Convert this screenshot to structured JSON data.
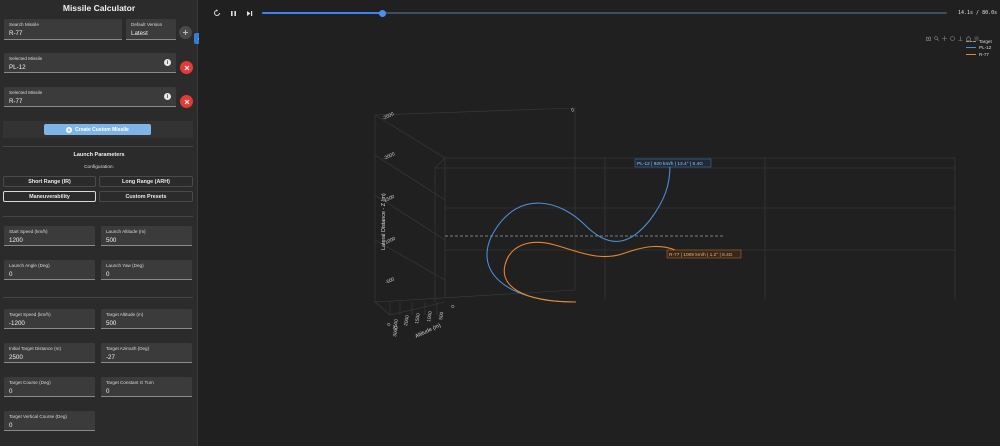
{
  "sidebar": {
    "title": "Missile Calculator",
    "search": {
      "label": "Search Missile",
      "value": "R-77"
    },
    "version": {
      "label": "Default Version",
      "value": "Latest"
    },
    "selected": [
      {
        "label": "Selected Missile",
        "value": "PL-12"
      },
      {
        "label": "Selected Missile",
        "value": "R-77"
      }
    ],
    "info_glyph": "i",
    "create_label": "Create Custom Missile",
    "launch_title": "Launch Parameters",
    "config_label": "Configuration:",
    "presets": [
      "Short Range (IR)",
      "Long Range (ARH)",
      "Maneuverability",
      "Custom Presets"
    ],
    "active_preset": "Maneuverability",
    "launch_fields": [
      {
        "label": "Start Speed (km/h)",
        "value": "1200"
      },
      {
        "label": "Launch Altitude (m)",
        "value": "500"
      },
      {
        "label": "Launch Angle (Deg)",
        "value": "0"
      },
      {
        "label": "Launch Yaw (Deg)",
        "value": "0"
      }
    ],
    "target_fields": [
      {
        "label": "Target Speed (km/h)",
        "value": "-1200"
      },
      {
        "label": "Target Altitude (m)",
        "value": "500"
      },
      {
        "label": "Initial Target Distance (m)",
        "value": "2500"
      },
      {
        "label": "Target Azimuth (Deg)",
        "value": "-27"
      },
      {
        "label": "Target Course (Deg)",
        "value": "0"
      },
      {
        "label": "Target Constant G Turn",
        "value": "0"
      },
      {
        "label": "Target Vertical Course (Deg)",
        "value": "0"
      }
    ]
  },
  "player": {
    "time_readout": "14.1s / 80.0s",
    "progress": 0.176
  },
  "colors": {
    "accent": "#3b82f6",
    "pl12": "#4a8fd4",
    "r77": "#e8862f",
    "target": "#9a9a9a",
    "delete": "#e53935"
  },
  "chart_data": {
    "type": "line",
    "projection": "3d",
    "series": [
      {
        "name": "Target",
        "style": "dashed"
      },
      {
        "name": "PL-12"
      },
      {
        "name": "R-77"
      }
    ],
    "axes": {
      "x": {
        "label": "Altitude (m)",
        "ticks": [
          "0",
          "500",
          "1000",
          "1500",
          "2000",
          "2500",
          "3000"
        ]
      },
      "z": {
        "label": "Lateral Distance - Z (m)",
        "ticks": [
          "-2500",
          "-2000",
          "1500",
          "1000",
          "-500",
          "0"
        ]
      }
    },
    "annotations": [
      {
        "series": "PL-12",
        "text": "PL-12 | 920 km/h | 13.4° | 6.4G"
      },
      {
        "series": "R-77",
        "text": "R-77 | 1009 km/h | 1.2° | 6.4G"
      }
    ]
  }
}
